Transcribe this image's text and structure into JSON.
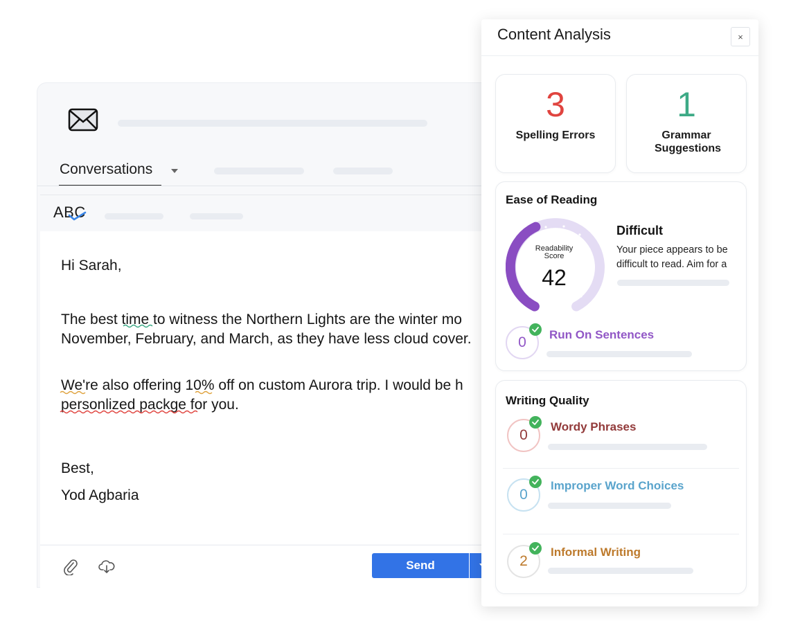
{
  "composer": {
    "tab_label": "Conversations",
    "toolbar_spell_label": "ABC",
    "body_lines": [
      "Hi Sarah,",
      "The best time to witness the Northern Lights are the winter mo",
      "November, February, and March, as they have less cloud cover.",
      "We're also offering 10% off on custom Aurora trip. I would be h",
      "personlized packge for you.",
      "Best,",
      "Yod Agbaria"
    ],
    "send_label": "Send",
    "accent_color": "#3273e6"
  },
  "panel": {
    "title": "Content Analysis",
    "close_label": "×",
    "spelling": {
      "count": "3",
      "label": "Spelling Errors",
      "color": "#e0443f"
    },
    "grammar": {
      "count": "1",
      "label": "Grammar Suggestions",
      "color": "#3daa86"
    },
    "ease": {
      "title": "Ease of Reading",
      "score_label": "Readability Score",
      "score": "42",
      "score_fraction": 0.42,
      "level": "Difficult",
      "description": "Your piece appears to be difficult to read. Aim for a",
      "run_on": {
        "count": "0",
        "label": "Run On Sentences",
        "color": "#9157c6"
      }
    },
    "quality": {
      "title": "Writing Quality",
      "items": [
        {
          "count": "0",
          "label": "Wordy Phrases",
          "color": "#923a3a",
          "circle": "#f1c4c3"
        },
        {
          "count": "0",
          "label": "Improper Word Choices",
          "color": "#5aa4cc",
          "circle": "#c7e2f1"
        },
        {
          "count": "2",
          "label": "Informal Writing",
          "color": "#bd7a2c",
          "circle": "#e4e4e4"
        }
      ]
    }
  }
}
